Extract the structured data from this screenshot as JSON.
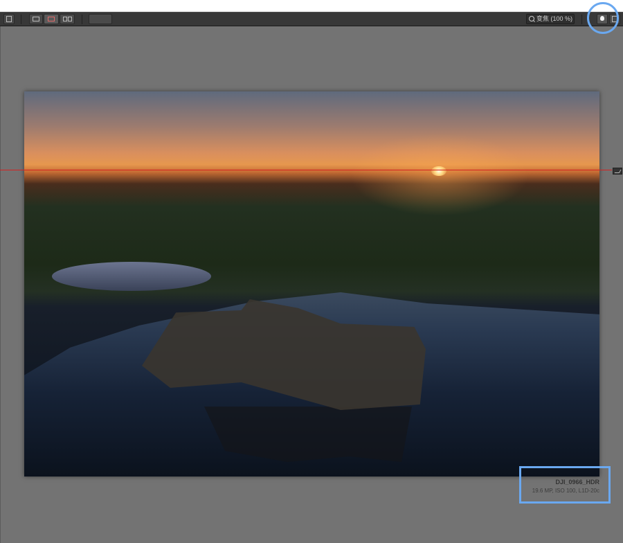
{
  "toolbar": {
    "compare_label": "",
    "zoom_label": "变焦 (100 %)",
    "icons": [
      "panel-toggle-icon",
      "single-view-icon",
      "split-view-icon",
      "side-by-side-view-icon",
      "lightbulb-icon",
      "panel-layout-icon"
    ]
  },
  "image": {
    "name": "DJI_0966_HDR",
    "meta": "19.6 MP, ISO 100, L1D-20c"
  },
  "annotations": {
    "highlight_color": "#6aa8f0"
  },
  "colors": {
    "workspace": "#737373",
    "toolbar": "#383838",
    "horizon_line": "#d32222"
  }
}
